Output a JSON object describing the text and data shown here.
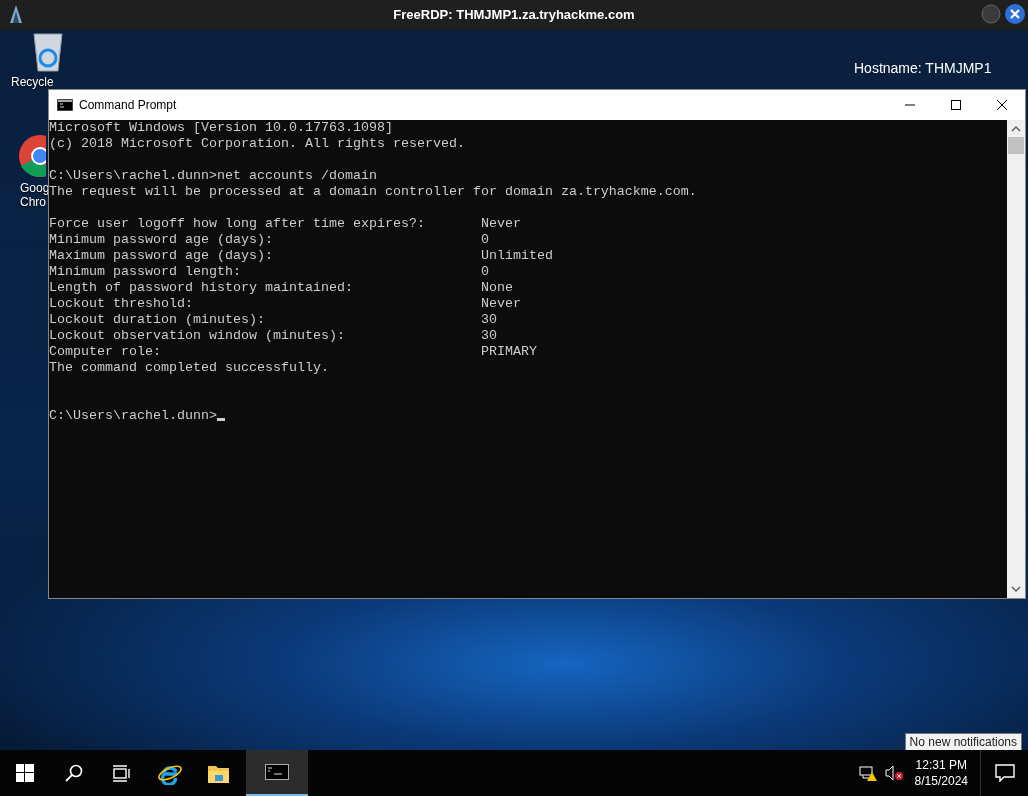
{
  "rdp_window": {
    "title": "FreeRDP: THMJMP1.za.tryhackme.com"
  },
  "desktop": {
    "icons": [
      {
        "kind": "recycle",
        "lines": [
          "Recycle"
        ]
      },
      {
        "kind": "chrome",
        "lines": [
          "Goog",
          "Chro"
        ]
      }
    ],
    "info": [
      "Hostname: THMJMP1"
    ]
  },
  "cmd_window": {
    "title": "Command Prompt",
    "lines": [
      {
        "kind": "text",
        "text": "Microsoft Windows [Version 10.0.17763.1098]"
      },
      {
        "kind": "text",
        "text": "(c) 2018 Microsoft Corporation. All rights reserved."
      },
      {
        "kind": "blank"
      },
      {
        "kind": "text",
        "text": "C:\\Users\\rachel.dunn>net accounts /domain"
      },
      {
        "kind": "text",
        "text": "The request will be processed at a domain controller for domain za.tryhackme.com."
      },
      {
        "kind": "blank"
      },
      {
        "kind": "setting",
        "label": "Force user logoff how long after time expires?:",
        "value": "Never"
      },
      {
        "kind": "setting",
        "label": "Minimum password age (days):",
        "value": "0"
      },
      {
        "kind": "setting",
        "label": "Maximum password age (days):",
        "value": "Unlimited"
      },
      {
        "kind": "setting",
        "label": "Minimum password length:",
        "value": "0"
      },
      {
        "kind": "setting",
        "label": "Length of password history maintained:",
        "value": "None"
      },
      {
        "kind": "setting",
        "label": "Lockout threshold:",
        "value": "Never"
      },
      {
        "kind": "setting",
        "label": "Lockout duration (minutes):",
        "value": "30"
      },
      {
        "kind": "setting",
        "label": "Lockout observation window (minutes):",
        "value": "30"
      },
      {
        "kind": "setting",
        "label": "Computer role:",
        "value": "PRIMARY"
      },
      {
        "kind": "text",
        "text": "The command completed successfully."
      },
      {
        "kind": "blank"
      },
      {
        "kind": "blank"
      },
      {
        "kind": "prompt",
        "text": "C:\\Users\\rachel.dunn>"
      }
    ]
  },
  "tooltip": "No new notifications",
  "taskbar": {
    "buttons": [
      {
        "kind": "start",
        "selected": false
      },
      {
        "kind": "search",
        "selected": false
      },
      {
        "kind": "taskview",
        "selected": false
      },
      {
        "kind": "ie",
        "selected": false
      },
      {
        "kind": "explorer",
        "selected": false
      },
      {
        "kind": "cmd",
        "selected": true
      }
    ],
    "time": "12:31 PM",
    "date": "8/15/2024"
  }
}
